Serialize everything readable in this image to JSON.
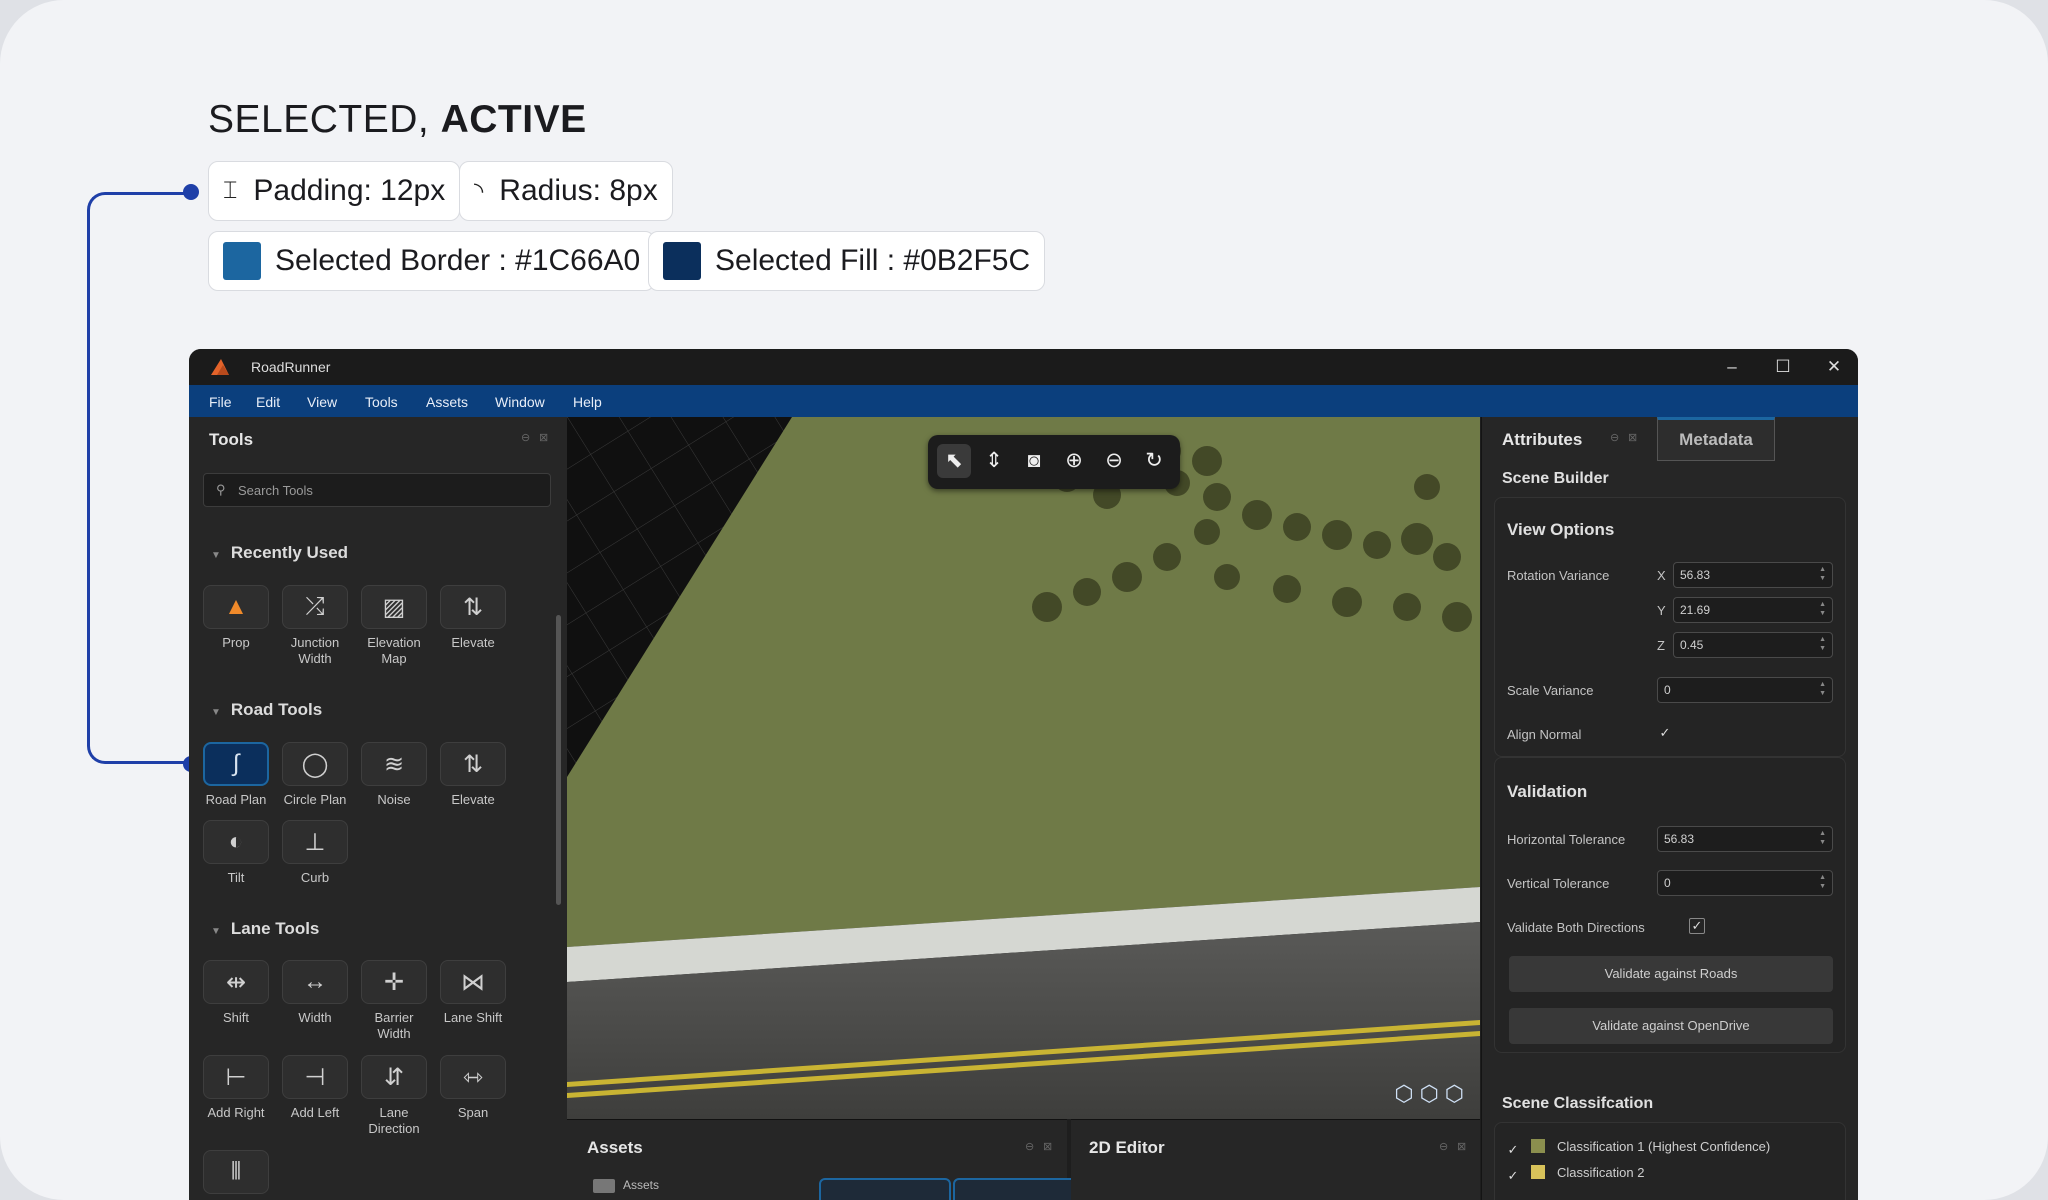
{
  "spec": {
    "title_prefix": "SELECTED, ",
    "title_emphasis": "ACTIVE",
    "padding": "Padding: 12px",
    "radius": "Radius: 8px",
    "selected_border": "Selected Border : #1C66A0",
    "selected_fill": "Selected Fill : #0B2F5C",
    "colors": {
      "selected_border": "#1C66A0",
      "selected_fill": "#0B2F5C",
      "connector": "#1F3FA8"
    }
  },
  "window": {
    "title": "RoadRunner",
    "controls": [
      "minimize-icon",
      "maximize-icon",
      "close-icon"
    ]
  },
  "menu": [
    "File",
    "Edit",
    "View",
    "Tools",
    "Assets",
    "Window",
    "Help"
  ],
  "tools_panel": {
    "title": "Tools",
    "search_placeholder": "Search Tools",
    "sections": [
      {
        "name": "Recently Used",
        "items": [
          "Prop",
          "Junction Width",
          "Elevation Map",
          "Elevate"
        ]
      },
      {
        "name": "Road Tools",
        "items": [
          "Road Plan",
          "Circle Plan",
          "Noise",
          "Elevate",
          "Tilt",
          "Curb"
        ],
        "selected": "Road Plan"
      },
      {
        "name": "Lane Tools",
        "items": [
          "Shift",
          "Width",
          "Barrier Width",
          "Lane Shift",
          "Add Right",
          "Add Left",
          "Lane Direction",
          "Span"
        ]
      }
    ]
  },
  "viewport_toolbar": [
    "select-icon",
    "measure-icon",
    "camera-icon",
    "zoom-in-icon",
    "zoom-out-icon",
    "refresh-icon"
  ],
  "bottom_panels": {
    "assets_title": "Assets",
    "assets_root": "Assets",
    "editor_title": "2D Editor"
  },
  "attributes": {
    "tab_attributes": "Attributes",
    "tab_metadata": "Metadata",
    "scene_builder": "Scene Builder",
    "view_options": {
      "title": "View Options",
      "rotation_label": "Rotation Variance",
      "x_label": "X",
      "x": "56.83",
      "y_label": "Y",
      "y": "21.69",
      "z_label": "Z",
      "z": "0.45",
      "scale_label": "Scale Variance",
      "scale": "0",
      "align_label": "Align Normal",
      "align_checked": true
    },
    "validation": {
      "title": "Validation",
      "horizontal_label": "Horizontal Tolerance",
      "horizontal": "56.83",
      "vertical_label": "Vertical Tolerance",
      "vertical": "0",
      "both_label": "Validate Both Directions",
      "both_checked": true,
      "btn_roads": "Validate against Roads",
      "btn_opendrive": "Validate against OpenDrive"
    },
    "scene_classification": {
      "title": "Scene Classifcation",
      "items": [
        {
          "label": "Classification 1 (Highest Confidence)",
          "color": "#8B8F4E",
          "checked": true
        },
        {
          "label": "Classification 2",
          "color": "#D8C25A",
          "checked": true
        }
      ]
    }
  }
}
